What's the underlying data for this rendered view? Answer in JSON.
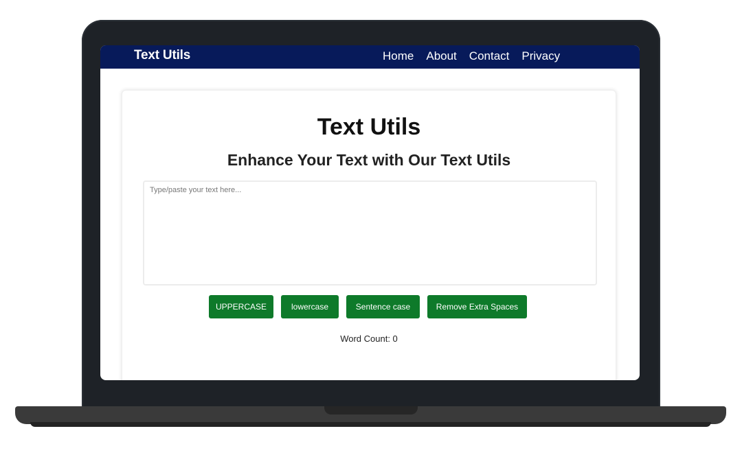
{
  "navbar": {
    "brand": "Text Utils",
    "links": [
      "Home",
      "About",
      "Contact",
      "Privacy"
    ]
  },
  "main": {
    "title": "Text Utils",
    "subtitle": "Enhance Your Text with Our Text Utils",
    "textarea": {
      "value": "",
      "placeholder": "Type/paste your text here..."
    },
    "buttons": {
      "uppercase": "UPPERCASE",
      "lowercase": "lowercase",
      "sentence_case": "Sentence case",
      "remove_extra_spaces": "Remove Extra Spaces"
    },
    "word_count_label": "Word Count: 0"
  },
  "colors": {
    "navbar_bg": "#071a5a",
    "button_bg": "#0e7a2a",
    "laptop_frame": "#1e2227"
  }
}
